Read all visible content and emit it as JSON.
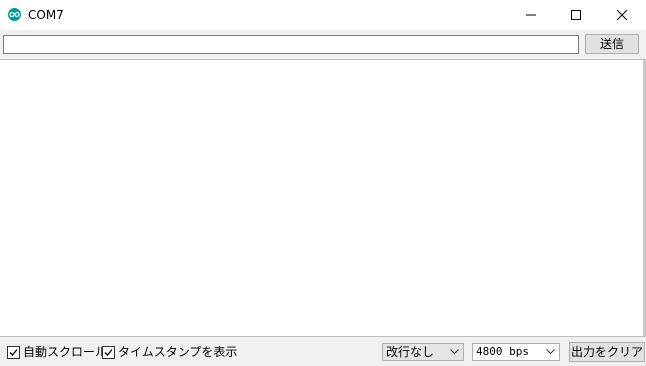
{
  "window": {
    "title": "COM7",
    "icon": "arduino-icon"
  },
  "send": {
    "input_value": "",
    "button_label": "送信"
  },
  "output": {
    "text": ""
  },
  "footer": {
    "autoscroll": {
      "label": "自動スクロール",
      "checked": true
    },
    "timestamp": {
      "label": "タイムスタンプを表示",
      "checked": true
    },
    "line_ending": "改行なし",
    "baud_rate": "4800 bps",
    "clear_label": "出力をクリア"
  },
  "colors": {
    "accent": "#00979d"
  }
}
